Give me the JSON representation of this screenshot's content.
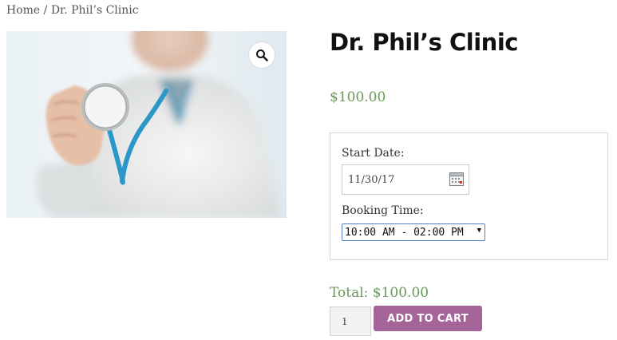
{
  "breadcrumb": {
    "home": "Home",
    "separator": " / ",
    "current": "Dr. Phil’s Clinic"
  },
  "product": {
    "title": "Dr. Phil’s Clinic",
    "price": "$100.00",
    "image_icon": "zoom-icon"
  },
  "booking": {
    "start_date_label": "Start Date:",
    "start_date_value": "11/30/17",
    "booking_time_label": "Booking Time:",
    "booking_time_value": "10:00 AM - 02:00 PM"
  },
  "cart": {
    "total": "Total: $100.00",
    "quantity": "1",
    "add_to_cart_label": "ADD TO CART"
  },
  "colors": {
    "accent_price": "#6a9a58",
    "button": "#a46497",
    "select_border": "#4f7fc9"
  }
}
